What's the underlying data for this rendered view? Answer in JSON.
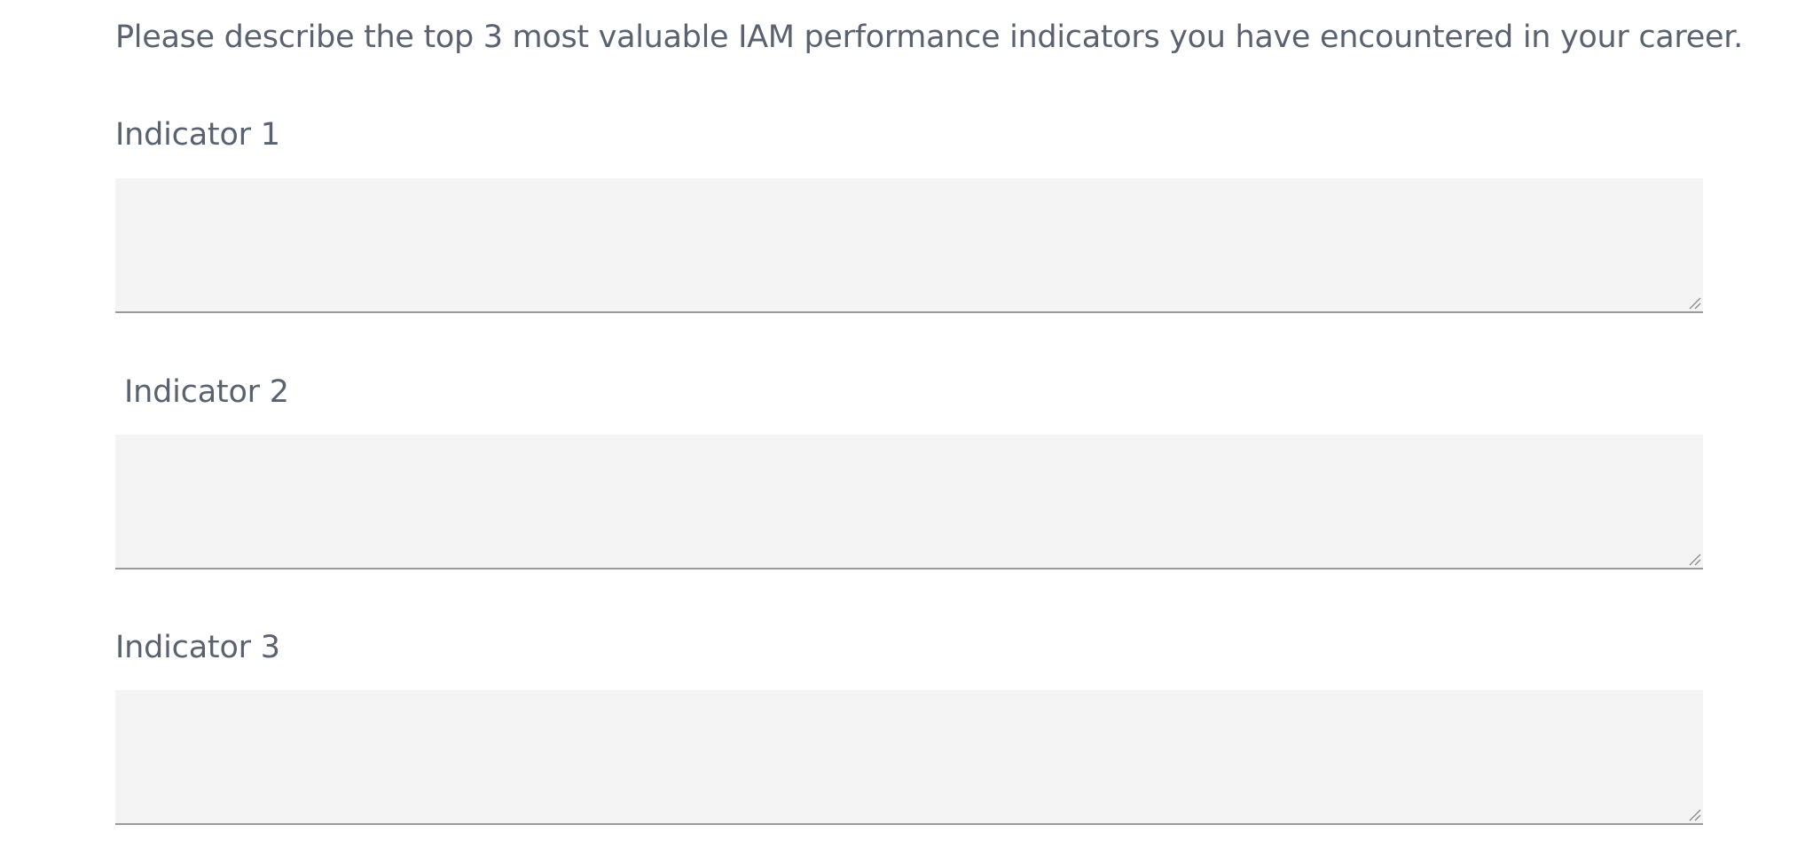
{
  "survey": {
    "question": "Please describe the top 3 most valuable IAM performance indicators you have encountered in your career.",
    "indicators": [
      {
        "label": "Indicator 1",
        "value": ""
      },
      {
        "label": " Indicator 2",
        "value": ""
      },
      {
        "label": "Indicator 3",
        "value": ""
      }
    ]
  },
  "icons": {
    "resize_handle": "resize-grip-icon"
  },
  "colors": {
    "text": "#5a6270",
    "field_background": "#f4f4f4",
    "field_underline": "#9a9a9a"
  }
}
